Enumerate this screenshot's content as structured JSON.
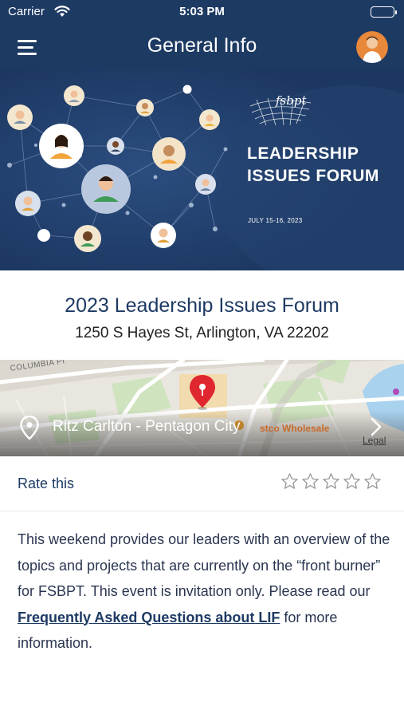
{
  "status_bar": {
    "carrier": "Carrier",
    "time": "5:03 PM"
  },
  "navbar": {
    "title": "General Info"
  },
  "hero": {
    "logo_text": "fsbpt",
    "forum_title": "LEADERSHIP ISSUES FORUM",
    "dates": "JULY 15-16, 2023"
  },
  "event": {
    "title": "2023 Leadership Issues Forum",
    "address": "1250 S Hayes St, Arlington, VA 22202"
  },
  "map": {
    "place_name": "Ritz Carlton - Pentagon City",
    "street_label": "COLUMBIA PI",
    "poi_label": "stco Wholesale",
    "legal_label": "Legal"
  },
  "rating": {
    "label": "Rate this",
    "stars_total": 5,
    "stars_filled": 0
  },
  "description": {
    "text_before": "This weekend provides our leaders with an overview of the topics and projects that are currently on the “front burner” for FSBPT. This event is invitation only. Please read our ",
    "link_text": "Frequently Asked Questions about LIF",
    "text_after": " for more information."
  },
  "colors": {
    "brand_navy": "#1d3a63",
    "hero_bg": "#203d68",
    "map_pin": "#e0272f"
  }
}
